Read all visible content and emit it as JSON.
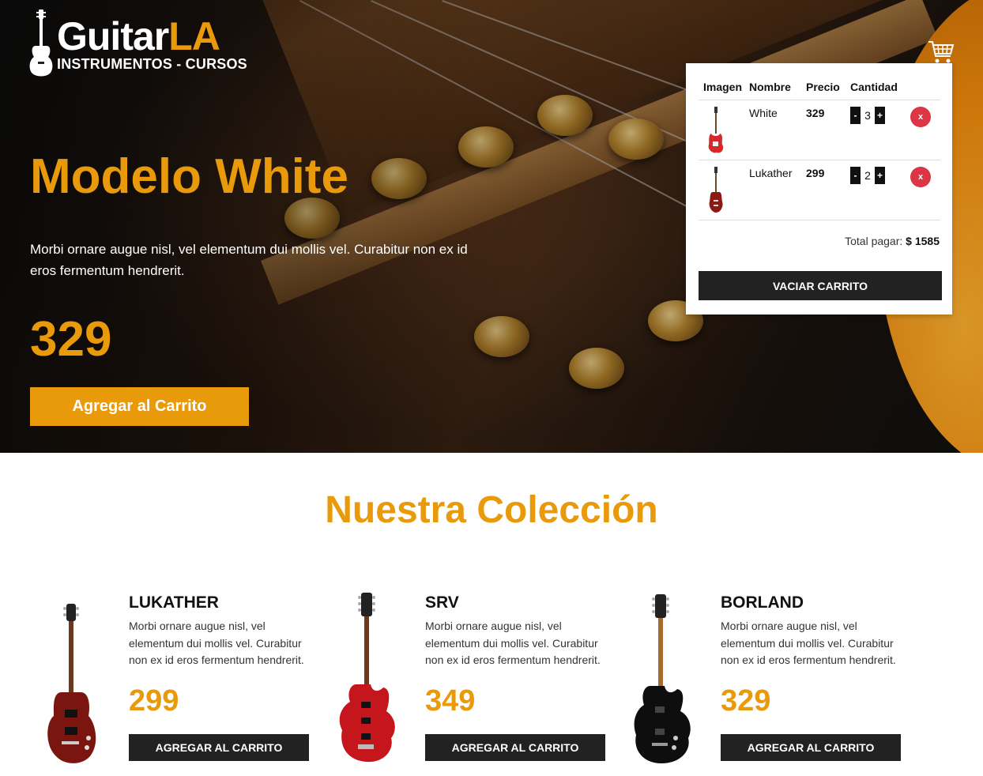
{
  "header": {
    "logo_main": "Guitar",
    "logo_accent": "LA",
    "logo_sub": "INSTRUMENTOS - CURSOS"
  },
  "hero": {
    "title": "Modelo White",
    "description": "Morbi ornare augue nisl, vel elementum dui mollis vel. Curabitur non ex id eros fermentum hendrerit.",
    "price": "329",
    "button_label": "Agregar al Carrito"
  },
  "cart": {
    "headers": [
      "Imagen",
      "Nombre",
      "Precio",
      "Cantidad"
    ],
    "items": [
      {
        "name": "White",
        "price": "329",
        "qty": "3",
        "minus": "-",
        "plus": "+",
        "delete": "x"
      },
      {
        "name": "Lukather",
        "price": "299",
        "qty": "2",
        "minus": "-",
        "plus": "+",
        "delete": "x"
      }
    ],
    "total_label": "Total pagar:",
    "total_value": "$ 1585",
    "empty_button": "VACIAR CARRITO"
  },
  "collection": {
    "title": "Nuestra Colección",
    "products": [
      {
        "name": "LUKATHER",
        "description": "Morbi ornare augue nisl, vel elementum dui mollis vel. Curabitur non ex id eros fermentum hendrerit.",
        "price": "299",
        "button": "AGREGAR AL CARRITO"
      },
      {
        "name": "SRV",
        "description": "Morbi ornare augue nisl, vel elementum dui mollis vel. Curabitur non ex id eros fermentum hendrerit.",
        "price": "349",
        "button": "AGREGAR AL CARRITO"
      },
      {
        "name": "BORLAND",
        "description": "Morbi ornare augue nisl, vel elementum dui mollis vel. Curabitur non ex id eros fermentum hendrerit.",
        "price": "329",
        "button": "AGREGAR AL CARRITO"
      }
    ]
  },
  "colors": {
    "accent": "#e99a0a",
    "dark_button": "#222222",
    "delete_button": "#dc3545"
  },
  "icons": [
    "guitar-logo-icon",
    "shopping-cart-icon"
  ]
}
